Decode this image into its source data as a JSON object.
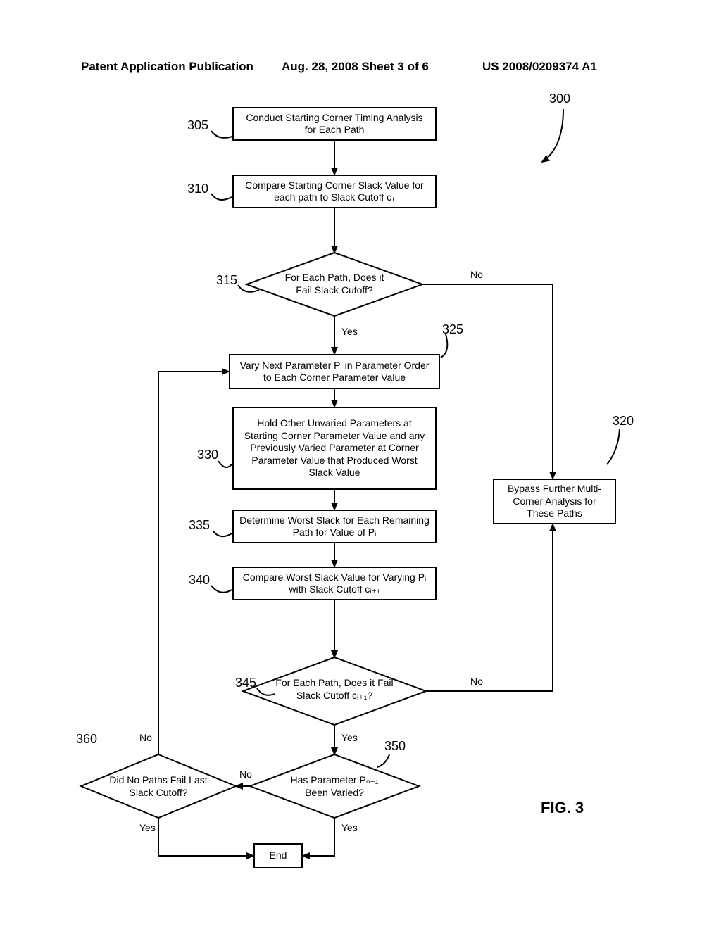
{
  "header": {
    "left": "Patent Application Publication",
    "mid": "Aug. 28, 2008  Sheet 3 of 6",
    "right": "US 2008/0209374 A1"
  },
  "refs": {
    "r300": "300",
    "r305": "305",
    "r310": "310",
    "r315": "315",
    "r320": "320",
    "r325": "325",
    "r330": "330",
    "r335": "335",
    "r340": "340",
    "r345": "345",
    "r350": "350",
    "r360": "360"
  },
  "labels": {
    "yes": "Yes",
    "no": "No"
  },
  "boxes": {
    "b305": "Conduct Starting Corner Timing Analysis for Each Path",
    "b310": "Compare Starting Corner Slack Value for each path to Slack Cutoff c₁",
    "d315": "For Each Path, Does it Fail Slack Cutoff?",
    "b320": "Bypass Further Multi-Corner Analysis for These Paths",
    "b325": "Vary Next Parameter Pᵢ in Parameter Order to Each Corner Parameter Value",
    "b330": "Hold Other Unvaried Parameters at Starting Corner Parameter Value and any Previously Varied Parameter at Corner Parameter Value that Produced Worst Slack Value",
    "b335": "Determine Worst Slack for Each Remaining Path for Value of Pᵢ",
    "b340": "Compare Worst Slack Value for Varying Pᵢ with Slack Cutoff cᵢ₊₁",
    "d345": "For Each Path, Does it Fail Slack Cutoff cᵢ₊₁?",
    "d350": "Has Parameter Pₙ₋₁ Been Varied?",
    "d360": "Did No Paths Fail Last Slack Cutoff?",
    "end": "End"
  },
  "figure": "FIG. 3"
}
